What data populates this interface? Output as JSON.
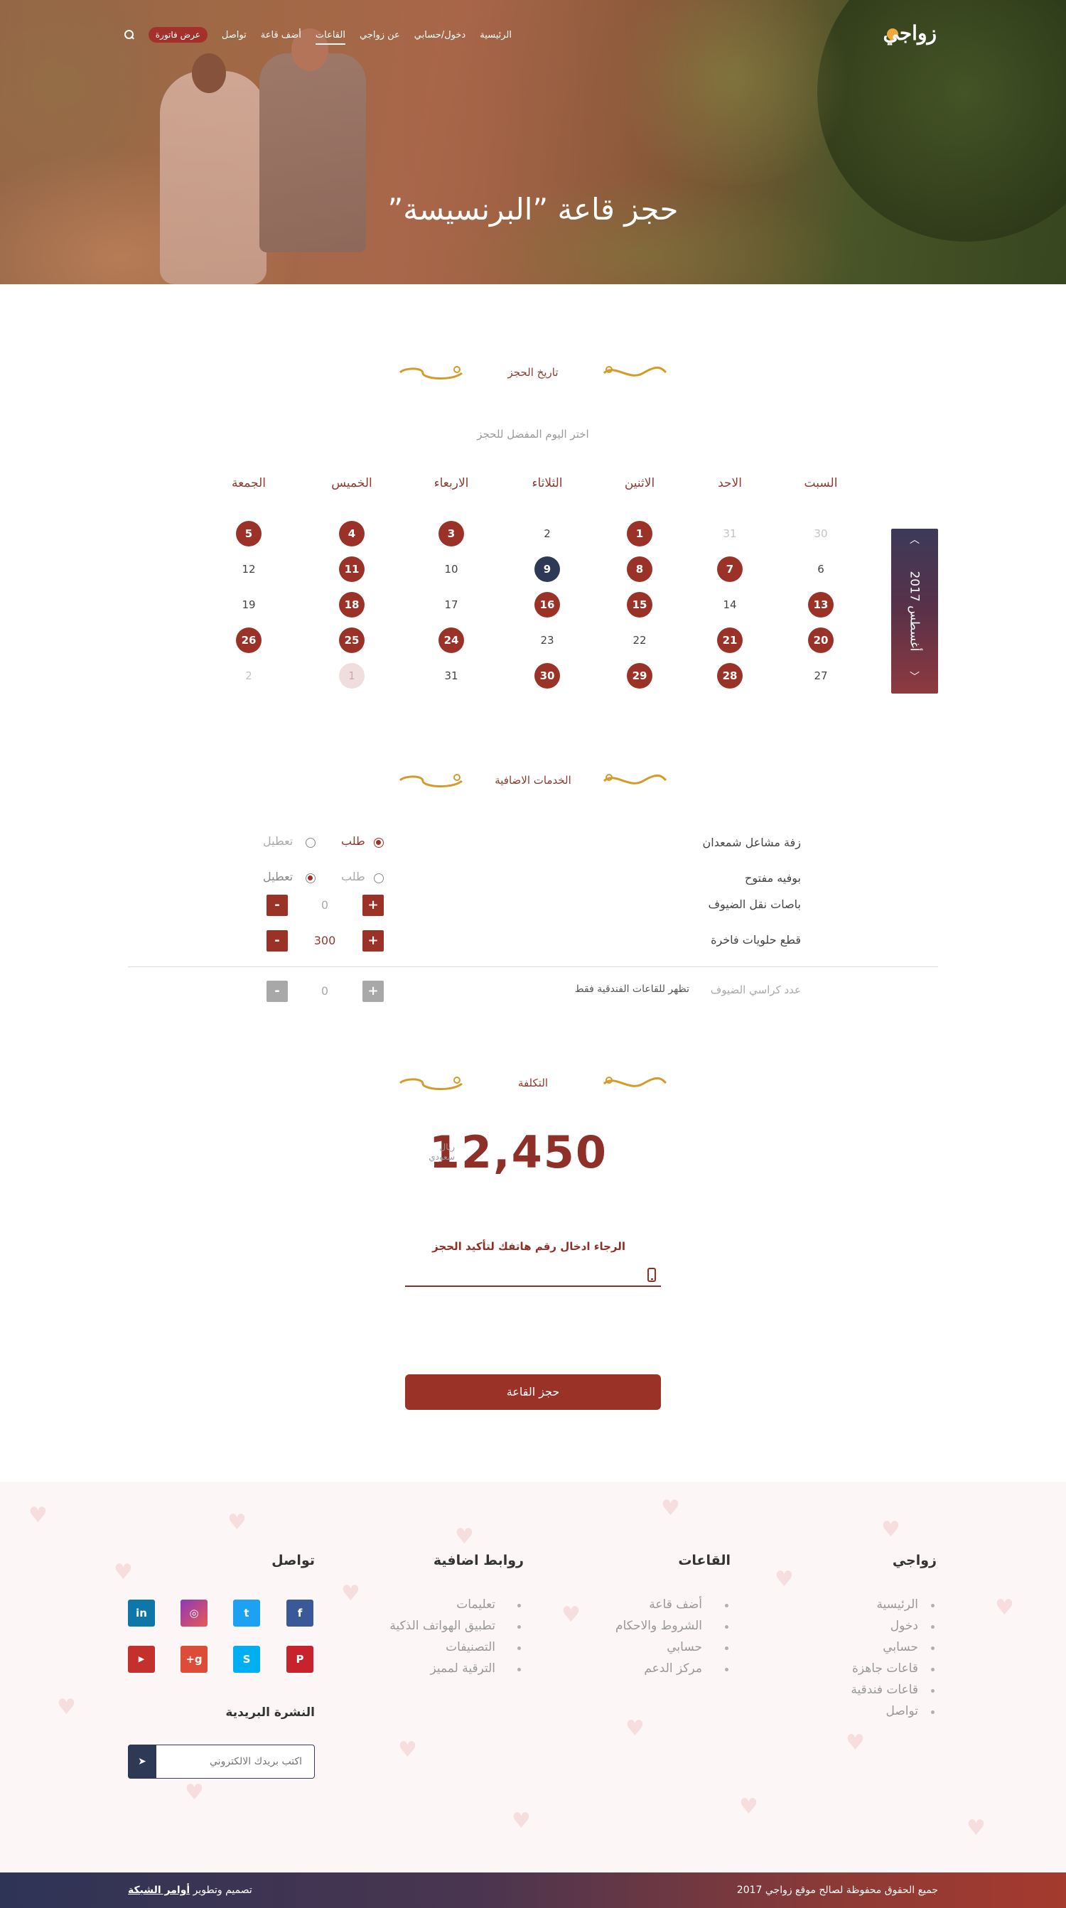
{
  "header": {
    "logo": "زواجي",
    "nav": [
      {
        "label": "الرئيسية",
        "active": false
      },
      {
        "label": "دخول/حسابي",
        "active": false
      },
      {
        "label": "عن زواجي",
        "active": false
      },
      {
        "label": "القاعات",
        "active": true
      },
      {
        "label": "أضف قاعة",
        "active": false
      },
      {
        "label": "تواصل",
        "active": false
      }
    ],
    "cta": "عرض فاتورة",
    "title": "حجز قاعة ”البرنسيسة”"
  },
  "booking_date": {
    "section_title": "تاريخ الحجز",
    "subtitle": "اختر اليوم المفضل للحجز",
    "month_label": "أغسطس 2017",
    "weekdays": [
      "السبت",
      "الاحد",
      "الاثنين",
      "الثلاثاء",
      "الاربعاء",
      "الخميس",
      "الجمعة"
    ],
    "weeks": [
      [
        {
          "d": "30",
          "s": "muted"
        },
        {
          "d": "31",
          "s": "muted"
        },
        {
          "d": "1",
          "s": "booked"
        },
        {
          "d": "2",
          "s": "free"
        },
        {
          "d": "3",
          "s": "booked"
        },
        {
          "d": "4",
          "s": "booked"
        },
        {
          "d": "5",
          "s": "booked"
        }
      ],
      [
        {
          "d": "6",
          "s": "free"
        },
        {
          "d": "7",
          "s": "booked"
        },
        {
          "d": "8",
          "s": "booked"
        },
        {
          "d": "9",
          "s": "today"
        },
        {
          "d": "10",
          "s": "free"
        },
        {
          "d": "11",
          "s": "booked"
        },
        {
          "d": "12",
          "s": "free"
        }
      ],
      [
        {
          "d": "13",
          "s": "booked"
        },
        {
          "d": "14",
          "s": "free"
        },
        {
          "d": "15",
          "s": "booked"
        },
        {
          "d": "16",
          "s": "booked"
        },
        {
          "d": "17",
          "s": "free"
        },
        {
          "d": "18",
          "s": "booked"
        },
        {
          "d": "19",
          "s": "free"
        }
      ],
      [
        {
          "d": "20",
          "s": "booked"
        },
        {
          "d": "21",
          "s": "booked"
        },
        {
          "d": "22",
          "s": "free"
        },
        {
          "d": "23",
          "s": "free"
        },
        {
          "d": "24",
          "s": "booked"
        },
        {
          "d": "25",
          "s": "booked"
        },
        {
          "d": "26",
          "s": "booked"
        }
      ],
      [
        {
          "d": "27",
          "s": "free"
        },
        {
          "d": "28",
          "s": "booked"
        },
        {
          "d": "29",
          "s": "booked"
        },
        {
          "d": "30",
          "s": "booked"
        },
        {
          "d": "31",
          "s": "free"
        },
        {
          "d": "1",
          "s": "selected"
        },
        {
          "d": "2",
          "s": "muted"
        }
      ]
    ]
  },
  "services": {
    "section_title": "الخدمات الاضافية",
    "option_request": "طلب",
    "option_disable": "تعطيل",
    "items": [
      {
        "label": "زفة مشاعل شمعدان",
        "type": "radio",
        "selected": "request"
      },
      {
        "label": "بوفيه مفتوح",
        "type": "radio",
        "selected": "disable"
      },
      {
        "label": "باصات نقل الضيوف",
        "type": "stepper",
        "value": "0"
      },
      {
        "label": "قطع حلويات فاخرة",
        "type": "stepper",
        "value": "300"
      }
    ],
    "plus": "+",
    "minus": "-",
    "chairs_label": "عدد كراسي الضيوف",
    "chairs_note": "تظهر للقاعات الفندقية فقط",
    "chairs_value": "0"
  },
  "cost": {
    "section_title": "التكلفة",
    "amount": "12,450",
    "currency_line1": "ريال",
    "currency_line2": "سعودي"
  },
  "confirm": {
    "phone_label": "الرجاء ادخال رقم هاتفك لتأكيد الحجز",
    "phone_value": "",
    "book_button": "حجز القاعة"
  },
  "footer": {
    "col1": {
      "title": "زواجي",
      "links": [
        "الرئيسية",
        "دخول",
        "حسابي",
        "قاعات جاهزة",
        "قاعات فندقية",
        "تواصل"
      ]
    },
    "col2": {
      "title": "القاعات",
      "links": [
        "أضف قاعة",
        "الشروط والاحكام",
        "حسابي",
        "مركز الدعم"
      ]
    },
    "col3": {
      "title": "روابط اضافية",
      "links": [
        "تعليمات",
        "تطبيق الهواتف الذكية",
        "التصنيفات",
        "الترقية لمميز"
      ]
    },
    "col4": {
      "title": "تواصل"
    },
    "social": [
      "facebook-icon",
      "twitter-icon",
      "instagram-icon",
      "linkedin-icon",
      "pinterest-icon",
      "skype-icon",
      "google-plus-icon",
      "youtube-icon"
    ],
    "newsletter_title": "النشرة البريدية",
    "newsletter_placeholder": "اكتب بريدك الالكتروني",
    "copyright": "جميع الحقوق محفوظة لصالح موقع زواجي 2017",
    "credit_prefix": "تصميم وتطوير",
    "credit_company": "أوامر الشبكة"
  },
  "colors": {
    "accent": "#9b3228",
    "today": "#2e3a55",
    "gold": "#e0a030"
  }
}
